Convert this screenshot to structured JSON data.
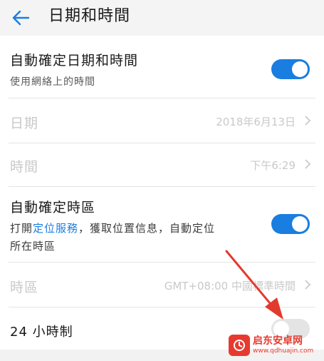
{
  "header": {
    "title": "日期和時間",
    "back_icon": "back-arrow-icon"
  },
  "auto_datetime": {
    "title": "自動確定日期和時間",
    "subtitle": "使用網絡上的時間",
    "enabled": true
  },
  "date_row": {
    "label": "日期",
    "value": "2018年6月13日"
  },
  "time_row": {
    "label": "時間",
    "value": "下午6:29"
  },
  "auto_timezone": {
    "title": "自動確定時區",
    "subtitle_prefix": "打開",
    "subtitle_link": "定位服務",
    "subtitle_suffix": "，獲取位置信息，自動定位",
    "subtitle_line2": "所在時區",
    "enabled": true
  },
  "timezone_row": {
    "label": "時區",
    "value": "GMT+08:00 中國標準時間"
  },
  "hour24_row": {
    "label": "24 小時制",
    "enabled": false
  },
  "watermark": {
    "name": "启东安卓网",
    "url": "www.qdhuajin.com"
  },
  "colors": {
    "accent": "#1a7de0",
    "arrow": "#e23a2e",
    "disabled_text": "#c9c9c9"
  }
}
